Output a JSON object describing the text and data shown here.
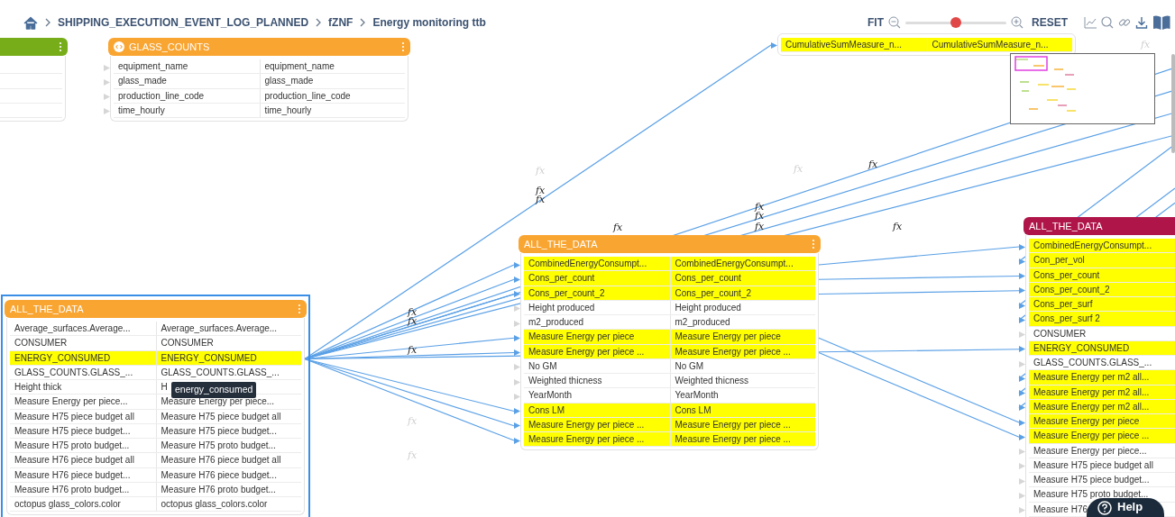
{
  "breadcrumb": {
    "items": [
      {
        "label": "SHIPPING_EXECUTION_EVENT_LOG_PLANNED"
      },
      {
        "label": "fZNF"
      },
      {
        "label": "Energy monitoring ttb"
      }
    ]
  },
  "zoom_bar": {
    "fit": "FIT",
    "level": 0.5,
    "reset": "RESET"
  },
  "nodes": [
    {
      "color": "#78ad1a",
      "menu": true,
      "selected": false,
      "rows": [
        {
          "highlighted": false
        },
        {
          "highlighted": false
        },
        {
          "highlighted": false
        },
        {
          "highlighted": false
        }
      ]
    },
    {
      "title": "GLASS_COUNTS",
      "color": "#f9a532",
      "icon": true,
      "menu": true,
      "selected": false,
      "ports": true,
      "rows": [
        {
          "cells": [
            "equipment_name",
            "equipment_name"
          ],
          "highlighted": false
        },
        {
          "cells": [
            "glass_made",
            "glass_made"
          ],
          "highlighted": false
        },
        {
          "cells": [
            "production_line_code",
            "production_line_code"
          ],
          "highlighted": false
        },
        {
          "cells": [
            "time_hourly",
            "time_hourly"
          ],
          "highlighted": false
        }
      ]
    },
    {
      "selected": false,
      "ports": true,
      "rows": [
        {
          "cells": [
            "CumulativeSumMeasure_n...",
            "CumulativeSumMeasure_n..."
          ],
          "highlighted": true
        }
      ]
    },
    {
      "title": "ALL_THE_DATA",
      "color": "#f9a532",
      "menu": true,
      "selected": true,
      "rows": [
        {
          "cells": [
            "Average_surfaces.Average...",
            "Average_surfaces.Average..."
          ],
          "highlighted": false
        },
        {
          "cells": [
            "CONSUMER",
            "CONSUMER"
          ],
          "highlighted": false
        },
        {
          "cells": [
            "ENERGY_CONSUMED",
            "ENERGY_CONSUMED"
          ],
          "highlighted": true
        },
        {
          "cells": [
            "GLASS_COUNTS.GLASS_...",
            "GLASS_COUNTS.GLASS_..."
          ],
          "highlighted": false
        },
        {
          "cells": [
            "Height thick",
            "H"
          ],
          "highlighted": false
        },
        {
          "cells": [
            "Measure Energy per piece...",
            "Measure Energy per piece..."
          ],
          "highlighted": false
        },
        {
          "cells": [
            "Measure H75 piece budget all",
            "Measure H75 piece budget all"
          ],
          "highlighted": false
        },
        {
          "cells": [
            "Measure H75 piece budget...",
            "Measure H75 piece budget..."
          ],
          "highlighted": false
        },
        {
          "cells": [
            "Measure H75 proto budget...",
            "Measure H75 proto budget..."
          ],
          "highlighted": false
        },
        {
          "cells": [
            "Measure H76 piece budget all",
            "Measure H76 piece budget all"
          ],
          "highlighted": false
        },
        {
          "cells": [
            "Measure H76 piece budget...",
            "Measure H76 piece budget..."
          ],
          "highlighted": false
        },
        {
          "cells": [
            "Measure H76 proto budget...",
            "Measure H76 proto budget..."
          ],
          "highlighted": false
        },
        {
          "cells": [
            "octopus glass_colors.color",
            "octopus glass_colors.color"
          ],
          "highlighted": false
        }
      ]
    },
    {
      "title": "ALL_THE_DATA",
      "color": "#f9a532",
      "menu": true,
      "selected": false,
      "ports": true,
      "rows": [
        {
          "cells": [
            "CombinedEnergyConsumpt...",
            "CombinedEnergyConsumpt..."
          ],
          "highlighted": true
        },
        {
          "cells": [
            "Cons_per_count",
            "Cons_per_count"
          ],
          "highlighted": true
        },
        {
          "cells": [
            "Cons_per_count_2",
            "Cons_per_count_2"
          ],
          "highlighted": true
        },
        {
          "cells": [
            "Height produced",
            "Height produced"
          ],
          "highlighted": false
        },
        {
          "cells": [
            "m2_produced",
            "m2_produced"
          ],
          "highlighted": false
        },
        {
          "cells": [
            "Measure Energy per piece",
            "Measure Energy per piece"
          ],
          "highlighted": true
        },
        {
          "cells": [
            "Measure Energy per piece ...",
            "Measure Energy per piece ..."
          ],
          "highlighted": true
        },
        {
          "cells": [
            "No GM",
            "No GM"
          ],
          "highlighted": false
        },
        {
          "cells": [
            "Weighted thicness",
            "Weighted thicness"
          ],
          "highlighted": false
        },
        {
          "cells": [
            "YearMonth",
            "YearMonth"
          ],
          "highlighted": false
        },
        {
          "cells": [
            "Cons LM",
            "Cons LM"
          ],
          "highlighted": true
        },
        {
          "cells": [
            "Measure Energy per piece ...",
            "Measure Energy per piece ..."
          ],
          "highlighted": true
        },
        {
          "cells": [
            "Measure Energy per piece ...",
            "Measure Energy per piece ..."
          ],
          "highlighted": true
        }
      ]
    },
    {
      "title": "ALL_THE_DATA",
      "color": "#b0154a",
      "selected": false,
      "ports": true,
      "rows": [
        {
          "cells": [
            "CombinedEnergyConsumpt..."
          ],
          "highlighted": true
        },
        {
          "cells": [
            "Con_per_vol"
          ],
          "highlighted": true
        },
        {
          "cells": [
            "Cons_per_count"
          ],
          "highlighted": true
        },
        {
          "cells": [
            "Cons_per_count_2"
          ],
          "highlighted": true
        },
        {
          "cells": [
            "Cons_per_surf"
          ],
          "highlighted": true
        },
        {
          "cells": [
            "Cons_per_surf 2"
          ],
          "highlighted": true
        },
        {
          "cells": [
            "CONSUMER"
          ],
          "highlighted": false
        },
        {
          "cells": [
            "ENERGY_CONSUMED"
          ],
          "highlighted": true
        },
        {
          "cells": [
            "GLASS_COUNTS.GLASS_..."
          ],
          "highlighted": false
        },
        {
          "cells": [
            "Measure Energy per m2 all..."
          ],
          "highlighted": true
        },
        {
          "cells": [
            "Measure Energy per m2 all..."
          ],
          "highlighted": true
        },
        {
          "cells": [
            "Measure Energy per m2 all..."
          ],
          "highlighted": true
        },
        {
          "cells": [
            "Measure Energy per piece"
          ],
          "highlighted": true
        },
        {
          "cells": [
            "Measure Energy per piece ..."
          ],
          "highlighted": true
        },
        {
          "cells": [
            "Measure Energy per piece..."
          ],
          "highlighted": false
        },
        {
          "cells": [
            "Measure H75 piece budget all"
          ],
          "highlighted": false
        },
        {
          "cells": [
            "Measure H75 piece budget..."
          ],
          "highlighted": false
        },
        {
          "cells": [
            "Measure H75 proto budget..."
          ],
          "highlighted": false
        },
        {
          "cells": [
            "Measure H76"
          ],
          "highlighted": false
        }
      ]
    }
  ],
  "function_marks": [
    {
      "label": "fx",
      "faded": true
    },
    {
      "label": "fx",
      "faded": true
    },
    {
      "label": "fx",
      "faded": true
    },
    {
      "label": "fx",
      "faded": false
    },
    {
      "label": "fx",
      "faded": false
    },
    {
      "label": "fx",
      "faded": false
    },
    {
      "label": "fx",
      "faded": false
    },
    {
      "label": "fx",
      "faded": false
    },
    {
      "label": "fx",
      "faded": false
    },
    {
      "label": "fx",
      "faded": false
    },
    {
      "label": "fx",
      "faded": false
    },
    {
      "label": "fx",
      "faded": false
    },
    {
      "label": "fx",
      "faded": false
    },
    {
      "label": "fx",
      "faded": false
    },
    {
      "label": "fx",
      "faded": true
    },
    {
      "label": "fx",
      "faded": true
    }
  ],
  "tooltip": {
    "text": "energy_consumed"
  },
  "help_button": {
    "label": "Help"
  }
}
